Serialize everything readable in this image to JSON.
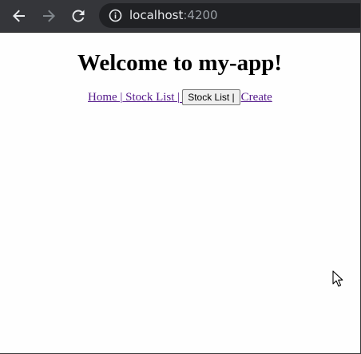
{
  "browser": {
    "url_host": "localhost",
    "url_port": ":4200",
    "icons": {
      "back": "back-arrow-icon",
      "forward": "forward-arrow-icon",
      "reload": "reload-icon",
      "info": "info-icon"
    }
  },
  "page": {
    "title": "Welcome to my-app!",
    "nav": {
      "home": "Home |",
      "stock_list_link": " Stock List |",
      "stock_list_button": "Stock List |",
      "create": "Create"
    }
  },
  "colors": {
    "toolbar": "#35363a",
    "omnibox": "#202124",
    "link": "#551a8b"
  }
}
